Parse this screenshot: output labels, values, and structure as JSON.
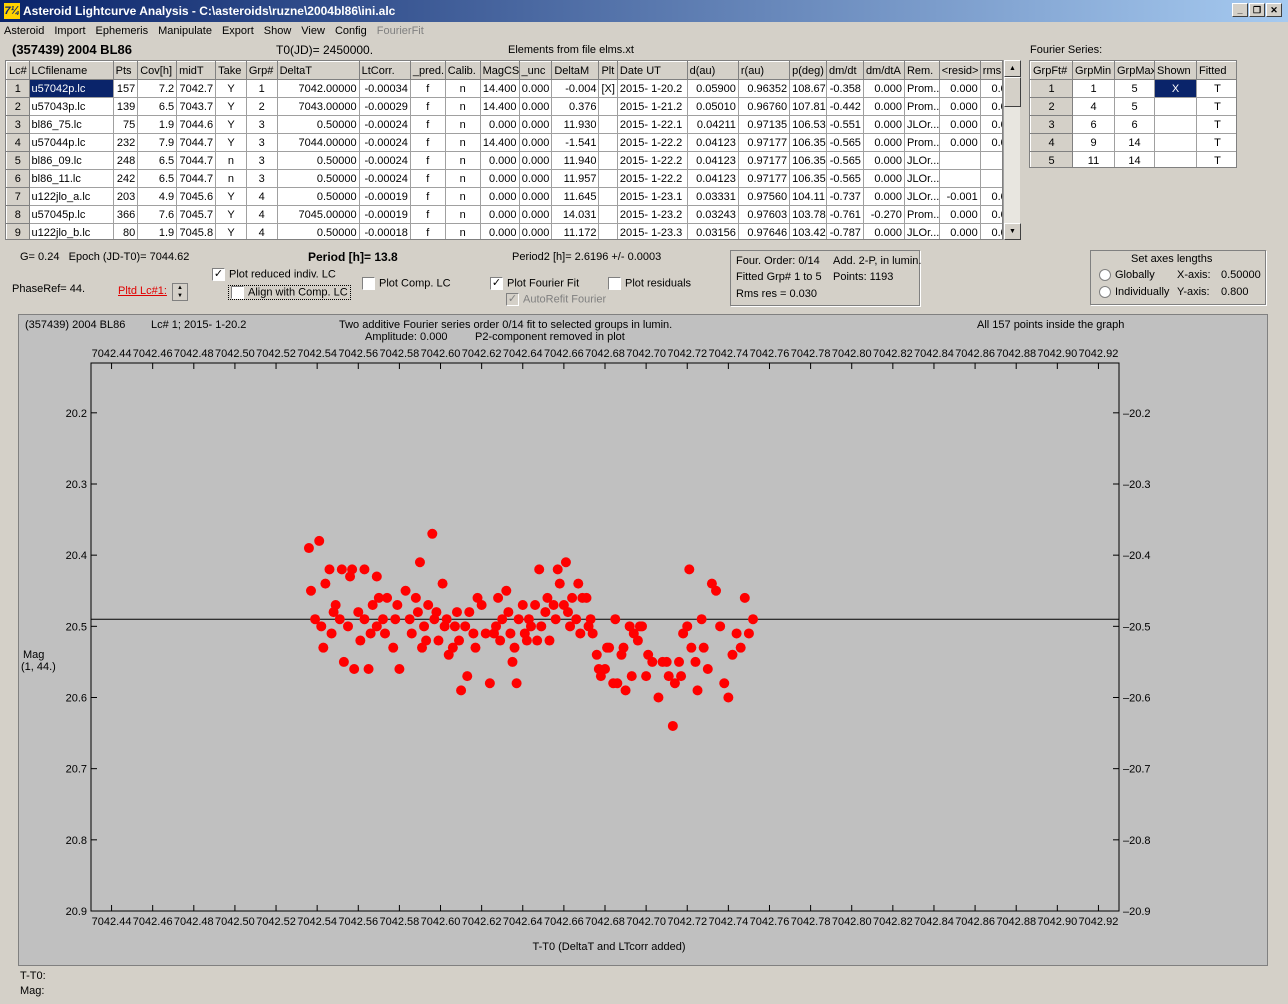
{
  "window": {
    "title": "Asteroid Lightcurve Analysis - C:\\asteroids\\ruzne\\2004bl86\\ini.alc",
    "icon": "7¼"
  },
  "menu": [
    "Asteroid",
    "Import",
    "Ephemeris",
    "Manipulate",
    "Export",
    "Show",
    "View",
    "Config",
    "FourierFit"
  ],
  "header": {
    "asteroid": "(357439) 2004 BL86",
    "t0": "T0(JD)= 2450000.",
    "elements": "Elements from file elms.xt",
    "fourier_title": "Fourier Series:"
  },
  "lc_table": {
    "columns": [
      "Lc#",
      "LCfilename",
      "Pts",
      "Cov[h]",
      "midT",
      "Take",
      "Grp#",
      "DeltaT",
      "LtCorr.",
      "_pred.",
      "Calib.",
      "MagCS",
      "_unc",
      "DeltaM",
      "Plt",
      "Date UT",
      "d(au)",
      "r(au)",
      "p(deg)",
      "dm/dt",
      "dm/dtA",
      "Rem.",
      "<resid>",
      "rms res"
    ],
    "rows": [
      [
        "1",
        "u57042p.lc",
        "157",
        "7.2",
        "7042.7",
        "Y",
        "1",
        "7042.00000",
        "-0.00034",
        "f",
        "n",
        "14.400",
        "0.000",
        "-0.004",
        "[X]",
        "2015- 1-20.2",
        "0.05900",
        "0.96352",
        "108.67",
        "-0.358",
        "0.000",
        "Prom...",
        "0.000",
        "0.043"
      ],
      [
        "2",
        "u57043p.lc",
        "139",
        "6.5",
        "7043.7",
        "Y",
        "2",
        "7043.00000",
        "-0.00029",
        "f",
        "n",
        "14.400",
        "0.000",
        "0.376",
        "",
        "2015- 1-21.2",
        "0.05010",
        "0.96760",
        "107.81",
        "-0.442",
        "0.000",
        "Prom...",
        "0.000",
        "0.034"
      ],
      [
        "3",
        "bl86_75.lc",
        "75",
        "1.9",
        "7044.6",
        "Y",
        "3",
        "0.50000",
        "-0.00024",
        "f",
        "n",
        "0.000",
        "0.000",
        "11.930",
        "",
        "2015- 1-22.1",
        "0.04211",
        "0.97135",
        "106.53",
        "-0.551",
        "0.000",
        "JLOr...",
        "0.000",
        "0.028"
      ],
      [
        "4",
        "u57044p.lc",
        "232",
        "7.9",
        "7044.7",
        "Y",
        "3",
        "7044.00000",
        "-0.00024",
        "f",
        "n",
        "14.400",
        "0.000",
        "-1.541",
        "",
        "2015- 1-22.2",
        "0.04123",
        "0.97177",
        "106.35",
        "-0.565",
        "0.000",
        "Prom...",
        "0.000",
        "0.030"
      ],
      [
        "5",
        "bl86_09.lc",
        "248",
        "6.5",
        "7044.7",
        "n",
        "3",
        "0.50000",
        "-0.00024",
        "f",
        "n",
        "0.000",
        "0.000",
        "11.940",
        "",
        "2015- 1-22.2",
        "0.04123",
        "0.97177",
        "106.35",
        "-0.565",
        "0.000",
        "JLOr...",
        "",
        ""
      ],
      [
        "6",
        "bl86_11.lc",
        "242",
        "6.5",
        "7044.7",
        "n",
        "3",
        "0.50000",
        "-0.00024",
        "f",
        "n",
        "0.000",
        "0.000",
        "11.957",
        "",
        "2015- 1-22.2",
        "0.04123",
        "0.97177",
        "106.35",
        "-0.565",
        "0.000",
        "JLOr...",
        "",
        ""
      ],
      [
        "7",
        "u122jlo_a.lc",
        "203",
        "4.9",
        "7045.6",
        "Y",
        "4",
        "0.50000",
        "-0.00019",
        "f",
        "n",
        "0.000",
        "0.000",
        "11.645",
        "",
        "2015- 1-23.1",
        "0.03331",
        "0.97560",
        "104.11",
        "-0.737",
        "0.000",
        "JLOr...",
        "-0.001",
        "0.022"
      ],
      [
        "8",
        "u57045p.lc",
        "366",
        "7.6",
        "7045.7",
        "Y",
        "4",
        "7045.00000",
        "-0.00019",
        "f",
        "n",
        "0.000",
        "0.000",
        "14.031",
        "",
        "2015- 1-23.2",
        "0.03243",
        "0.97603",
        "103.78",
        "-0.761",
        "-0.270",
        "Prom...",
        "0.000",
        "0.025"
      ],
      [
        "9",
        "u122jlo_b.lc",
        "80",
        "1.9",
        "7045.8",
        "Y",
        "4",
        "0.50000",
        "-0.00018",
        "f",
        "n",
        "0.000",
        "0.000",
        "11.172",
        "",
        "2015- 1-23.3",
        "0.03156",
        "0.97646",
        "103.42",
        "-0.787",
        "0.000",
        "JLOr...",
        "0.000",
        "0.027"
      ]
    ]
  },
  "fourier_table": {
    "columns": [
      "GrpFt#",
      "GrpMin",
      "GrpMax",
      "Shown",
      "Fitted"
    ],
    "rows": [
      [
        "1",
        "1",
        "5",
        "X",
        "T"
      ],
      [
        "2",
        "4",
        "5",
        "",
        "T"
      ],
      [
        "3",
        "6",
        "6",
        "",
        "T"
      ],
      [
        "4",
        "9",
        "14",
        "",
        "T"
      ],
      [
        "5",
        "11",
        "14",
        "",
        "T"
      ]
    ]
  },
  "controls": {
    "g": "G= 0.24",
    "epoch": "Epoch (JD-T0)= 7044.62",
    "period": "Period [h]= 13.8",
    "period2": "Period2 [h]= 2.6196 +/- 0.0003",
    "phaseref": "PhaseRef= 44.",
    "pltd": "Pltd Lc#1:",
    "plot_reduced": "Plot reduced indiv. LC",
    "align": "Align with Comp. LC",
    "plot_comp": "Plot Comp. LC",
    "plot_fourier": "Plot Fourier Fit",
    "plot_resid": "Plot residuals",
    "autorefit": "AutoRefit Fourier",
    "four_order": "Four. Order:  0/14",
    "add2p": "Add. 2-P, in lumin.",
    "fitted": "Fitted Grp# 1 to 5",
    "points": "Points: 1193",
    "rms": "Rms res    = 0.030",
    "axes_title": "Set axes lengths",
    "globally": "Globally",
    "individually": "Individually",
    "xaxis_lbl": "X-axis:",
    "xaxis_val": "0.50000",
    "yaxis_lbl": "Y-axis:",
    "yaxis_val": "0.800"
  },
  "plot": {
    "top_left": "(357439) 2004 BL86",
    "lc_info": "Lc# 1; 2015- 1-20.2",
    "title1": "Two additive Fourier series order 0/14 fit to selected groups in lumin.",
    "title2": "Amplitude: 0.000",
    "title3": "P2-component removed in plot",
    "right_info": "All 157 points inside the graph",
    "ylabel1": "Mag",
    "ylabel2": "(1, 44.)",
    "xlabel": "T-T0 (DeltaT and LTcorr added)",
    "footer1": "T-T0:",
    "footer2": "Mag:"
  },
  "chart_data": {
    "type": "scatter",
    "xlabel": "T-T0 (DeltaT and LTcorr added)",
    "ylabel": "Mag",
    "xlim": [
      7042.43,
      7042.93
    ],
    "ylim": [
      20.9,
      20.13
    ],
    "xticks": [
      7042.44,
      7042.46,
      7042.48,
      7042.5,
      7042.52,
      7042.54,
      7042.56,
      7042.58,
      7042.6,
      7042.62,
      7042.64,
      7042.66,
      7042.68,
      7042.7,
      7042.72,
      7042.74,
      7042.76,
      7042.78,
      7042.8,
      7042.82,
      7042.84,
      7042.86,
      7042.88,
      7042.9,
      7042.92
    ],
    "yticks": [
      20.2,
      20.3,
      20.4,
      20.5,
      20.6,
      20.7,
      20.8,
      20.9
    ],
    "fit_line": 20.49,
    "point_color": "#ff0000",
    "x": [
      7042.536,
      7042.537,
      7042.539,
      7042.541,
      7042.542,
      7042.543,
      7042.544,
      7042.546,
      7042.547,
      7042.548,
      7042.549,
      7042.551,
      7042.552,
      7042.553,
      7042.555,
      7042.556,
      7042.557,
      7042.558,
      7042.56,
      7042.561,
      7042.563,
      7042.563,
      7042.565,
      7042.566,
      7042.567,
      7042.569,
      7042.569,
      7042.57,
      7042.572,
      7042.573,
      7042.574,
      7042.577,
      7042.578,
      7042.579,
      7042.58,
      7042.583,
      7042.585,
      7042.586,
      7042.588,
      7042.589,
      7042.59,
      7042.591,
      7042.592,
      7042.593,
      7042.594,
      7042.596,
      7042.597,
      7042.598,
      7042.599,
      7042.601,
      7042.602,
      7042.603,
      7042.604,
      7042.606,
      7042.607,
      7042.608,
      7042.609,
      7042.61,
      7042.612,
      7042.613,
      7042.614,
      7042.616,
      7042.617,
      7042.618,
      7042.62,
      7042.622,
      7042.624,
      7042.626,
      7042.627,
      7042.628,
      7042.629,
      7042.63,
      7042.632,
      7042.633,
      7042.634,
      7042.635,
      7042.636,
      7042.637,
      7042.638,
      7042.64,
      7042.641,
      7042.642,
      7042.643,
      7042.644,
      7042.646,
      7042.647,
      7042.648,
      7042.649,
      7042.651,
      7042.652,
      7042.653,
      7042.655,
      7042.656,
      7042.657,
      7042.658,
      7042.66,
      7042.661,
      7042.662,
      7042.663,
      7042.664,
      7042.666,
      7042.667,
      7042.668,
      7042.669,
      7042.671,
      7042.672,
      7042.673,
      7042.674,
      7042.676,
      7042.677,
      7042.678,
      7042.68,
      7042.681,
      7042.682,
      7042.684,
      7042.685,
      7042.686,
      7042.688,
      7042.689,
      7042.69,
      7042.692,
      7042.693,
      7042.694,
      7042.696,
      7042.697,
      7042.698,
      7042.7,
      7042.701,
      7042.703,
      7042.706,
      7042.708,
      7042.71,
      7042.711,
      7042.713,
      7042.714,
      7042.716,
      7042.717,
      7042.718,
      7042.72,
      7042.721,
      7042.722,
      7042.724,
      7042.725,
      7042.727,
      7042.728,
      7042.73,
      7042.732,
      7042.734,
      7042.736,
      7042.738,
      7042.74,
      7042.742,
      7042.744,
      7042.746,
      7042.748,
      7042.75,
      7042.752
    ],
    "y": [
      20.39,
      20.45,
      20.49,
      20.38,
      20.5,
      20.53,
      20.44,
      20.42,
      20.51,
      20.48,
      20.47,
      20.49,
      20.42,
      20.55,
      20.5,
      20.43,
      20.42,
      20.56,
      20.48,
      20.52,
      20.49,
      20.42,
      20.56,
      20.51,
      20.47,
      20.43,
      20.5,
      20.46,
      20.49,
      20.51,
      20.46,
      20.53,
      20.49,
      20.47,
      20.56,
      20.45,
      20.49,
      20.51,
      20.46,
      20.48,
      20.41,
      20.53,
      20.5,
      20.52,
      20.47,
      20.37,
      20.49,
      20.48,
      20.52,
      20.44,
      20.5,
      20.49,
      20.54,
      20.53,
      20.5,
      20.48,
      20.52,
      20.59,
      20.5,
      20.57,
      20.48,
      20.51,
      20.53,
      20.46,
      20.47,
      20.51,
      20.58,
      20.51,
      20.5,
      20.46,
      20.52,
      20.49,
      20.45,
      20.48,
      20.51,
      20.55,
      20.53,
      20.58,
      20.49,
      20.47,
      20.51,
      20.52,
      20.49,
      20.5,
      20.47,
      20.52,
      20.42,
      20.5,
      20.48,
      20.46,
      20.52,
      20.47,
      20.49,
      20.42,
      20.44,
      20.47,
      20.41,
      20.48,
      20.5,
      20.46,
      20.49,
      20.44,
      20.51,
      20.46,
      20.46,
      20.5,
      20.49,
      20.51,
      20.54,
      20.56,
      20.57,
      20.56,
      20.53,
      20.53,
      20.58,
      20.49,
      20.58,
      20.54,
      20.53,
      20.59,
      20.5,
      20.57,
      20.51,
      20.52,
      20.5,
      20.5,
      20.57,
      20.54,
      20.55,
      20.6,
      20.55,
      20.55,
      20.57,
      20.64,
      20.58,
      20.55,
      20.57,
      20.51,
      20.5,
      20.42,
      20.53,
      20.55,
      20.59,
      20.49,
      20.53,
      20.56,
      20.44,
      20.45,
      20.5,
      20.58,
      20.6,
      20.54,
      20.51,
      20.53,
      20.46,
      20.51,
      20.49
    ]
  }
}
